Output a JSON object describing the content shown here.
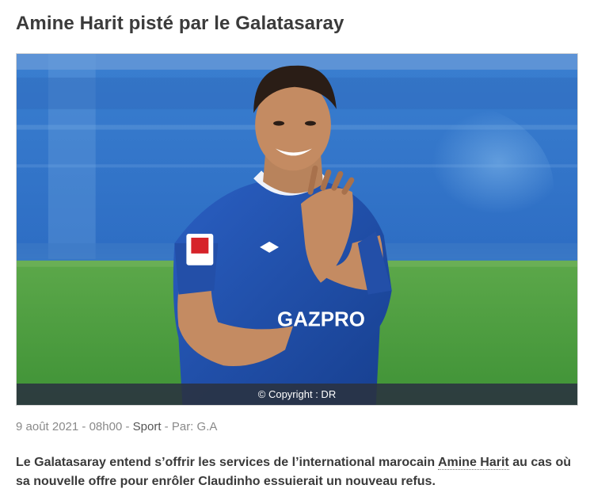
{
  "article": {
    "title": "Amine Harit pisté par le Galatasaray",
    "image": {
      "caption": "© Copyright : DR",
      "jersey_sponsor": "GAZPRO",
      "kit_brand": "umbro",
      "league_patch": "BUNDESLIGA"
    },
    "meta": {
      "date": "9 août 2021 - 08h00",
      "sep1": " - ",
      "category": "Sport",
      "sep2": " - ",
      "author": "Par: G.A"
    },
    "lead": {
      "before": "Le Galatasaray entend s’offrir les services de l’international marocain ",
      "link": "Amine Harit",
      "after": " au cas où sa nouvelle offre pour enrôler Claudinho essuierait un nouveau refus."
    }
  }
}
